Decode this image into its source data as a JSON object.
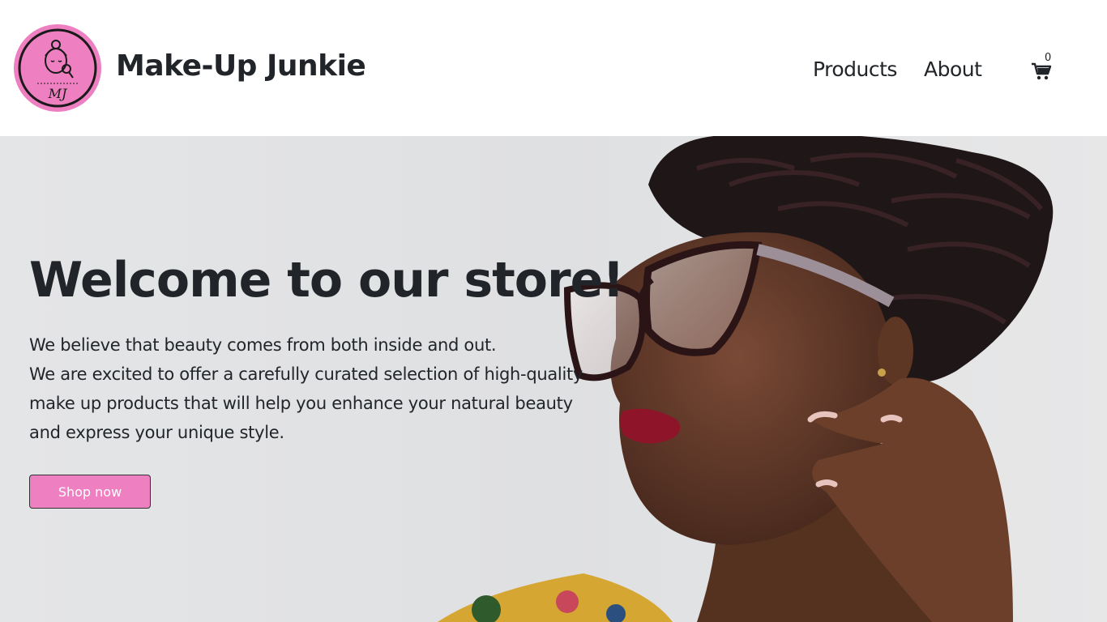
{
  "header": {
    "logo_text": "MJ",
    "brand": "Make-Up Junkie",
    "nav": {
      "products": "Products",
      "about": "About"
    },
    "cart": {
      "icon": "shopping-cart-icon",
      "count": "0"
    }
  },
  "hero": {
    "title": "Welcome to our store!",
    "paragraph_lines": [
      "We believe that beauty comes from both inside and out.",
      "We are excited to offer a carefully curated selection of high-quality make up products that will help you enhance your natural beauty and express your unique style."
    ],
    "button": "Shop now"
  },
  "colors": {
    "accent": "#ee7fc0",
    "text": "#212529",
    "hero_bg": "#e2e3e5"
  }
}
